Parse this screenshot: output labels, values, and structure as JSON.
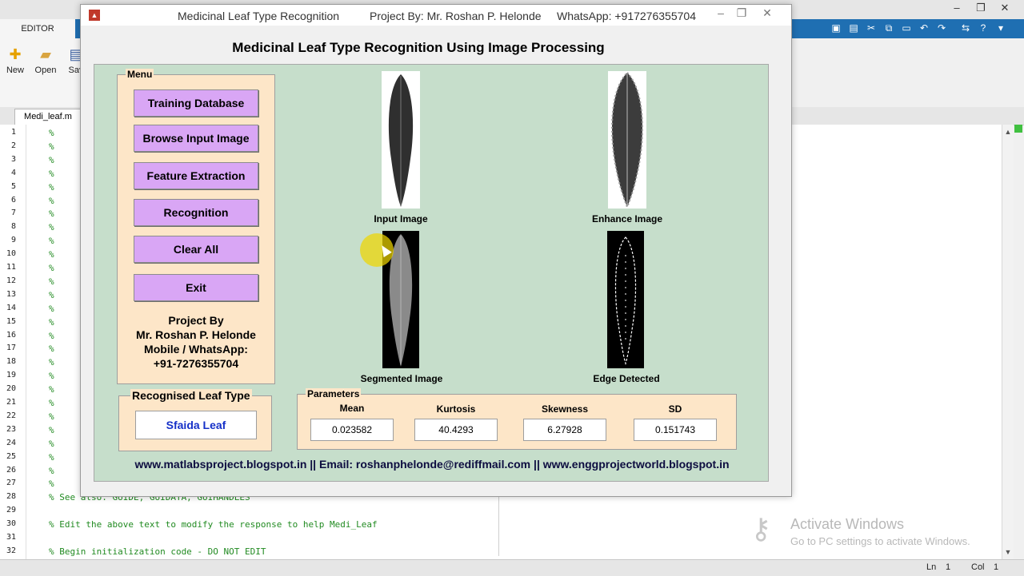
{
  "matlab": {
    "editor_tab": "EDITOR",
    "ribbon": [
      {
        "label": "New",
        "icon": "new-file-icon"
      },
      {
        "label": "Open",
        "icon": "folder-open-icon"
      },
      {
        "label": "Sav",
        "icon": "save-icon"
      }
    ],
    "file_tab": "Medi_leaf.m",
    "line_numbers": [
      "1",
      "2",
      "3",
      "4",
      "5",
      "6",
      "7",
      "8",
      "9",
      "10",
      "11",
      "12",
      "13",
      "14",
      "15",
      "16",
      "17",
      "18",
      "19",
      "20",
      "21",
      "22",
      "23",
      "24",
      "25",
      "26",
      "27",
      "28",
      "29",
      "30",
      "31",
      "32"
    ],
    "code_28": "% See also: GUIDE, GUIDATA, GUIHANDLES",
    "code_30": "% Edit the above text to modify the response to help Medi_Leaf",
    "code_32": "% Begin initialization code - DO NOT EDIT",
    "comment_char": "%",
    "status": {
      "ln_label": "Ln",
      "ln": "1",
      "col_label": "Col",
      "col": "1"
    }
  },
  "activation": {
    "title": "Activate Windows",
    "subtitle": "Go to PC settings to activate Windows."
  },
  "window": {
    "title": "Medicinal Leaf Type Recognition",
    "project_by": "Project By: Mr. Roshan P. Helonde",
    "whatsapp": "WhatsApp: +917276355704"
  },
  "gui": {
    "heading": "Medicinal Leaf Type Recognition Using Image Processing",
    "menu": {
      "title": "Menu",
      "buttons": [
        "Training Database",
        "Browse Input Image",
        "Feature Extraction",
        "Recognition",
        "Clear All",
        "Exit"
      ],
      "project": [
        "Project By",
        "Mr. Roshan P. Helonde",
        "Mobile / WhatsApp:",
        "+91-7276355704"
      ]
    },
    "recognised": {
      "title": "Recognised Leaf Type",
      "value": "Sfaida Leaf"
    },
    "images": {
      "input": "Input Image",
      "enhance": "Enhance Image",
      "segmented": "Segmented Image",
      "edge": "Edge Detected"
    },
    "parameters": {
      "title": "Parameters",
      "items": [
        {
          "label": "Mean",
          "value": "0.023582"
        },
        {
          "label": "Kurtosis",
          "value": "40.4293"
        },
        {
          "label": "Skewness",
          "value": "6.27928"
        },
        {
          "label": "SD",
          "value": "0.151743"
        }
      ]
    },
    "footer": "www.matlabsproject.blogspot.in || Email: roshanphelonde@rediffmail.com || www.enggprojectworld.blogspot.in"
  }
}
